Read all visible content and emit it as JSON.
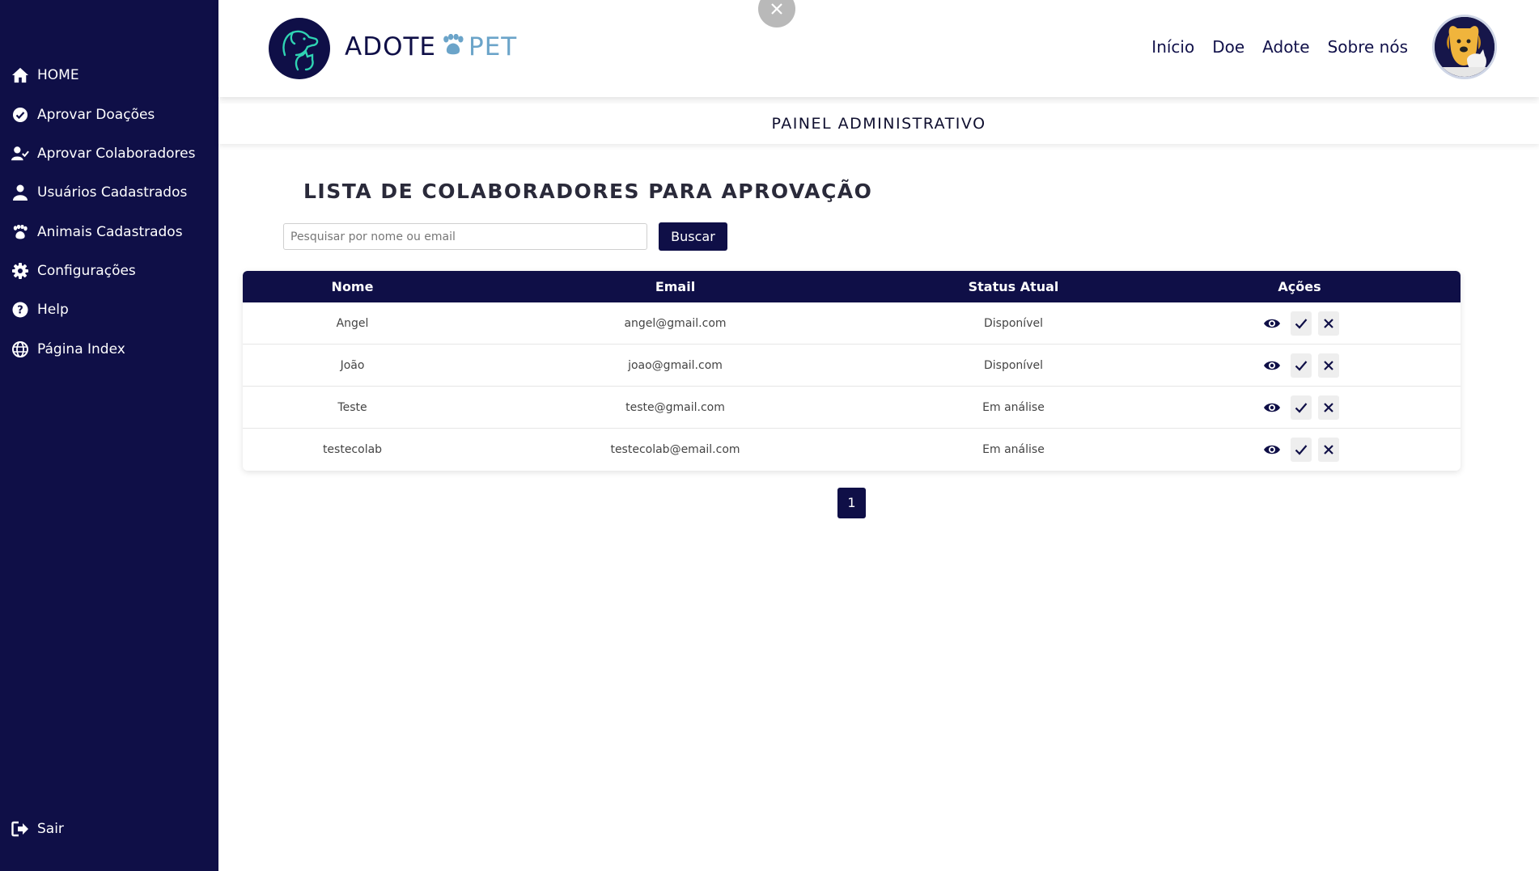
{
  "sidebar": {
    "items": [
      {
        "label": "HOME",
        "icon": "home-icon"
      },
      {
        "label": "Aprovar Doações",
        "icon": "check-circle-icon"
      },
      {
        "label": "Aprovar Colaboradores",
        "icon": "user-check-icon"
      },
      {
        "label": "Usuários Cadastrados",
        "icon": "user-icon"
      },
      {
        "label": "Animais Cadastrados",
        "icon": "paw-icon"
      },
      {
        "label": "Configurações",
        "icon": "gear-icon"
      },
      {
        "label": "Help",
        "icon": "question-circle-icon"
      },
      {
        "label": "Página Index",
        "icon": "globe-icon"
      }
    ],
    "logout_label": "Sair"
  },
  "header": {
    "brand_part1": "ADOTE",
    "brand_part2": "PET",
    "nav": [
      "Início",
      "Doe",
      "Adote",
      "Sobre nós"
    ]
  },
  "panel_title": "PAINEL ADMINISTRATIVO",
  "list_title": "LISTA DE COLABORADORES PARA APROVAÇÃO",
  "search": {
    "placeholder": "Pesquisar por nome ou email",
    "button_label": "Buscar"
  },
  "table": {
    "headers": [
      "Nome",
      "Email",
      "Status Atual",
      "Ações"
    ],
    "rows": [
      {
        "nome": "Angel",
        "email": "angel@gmail.com",
        "status": "Disponível"
      },
      {
        "nome": "João",
        "email": "joao@gmail.com",
        "status": "Disponível"
      },
      {
        "nome": "Teste",
        "email": "teste@gmail.com",
        "status": "Em análise"
      },
      {
        "nome": "testecolab",
        "email": "testecolab@email.com",
        "status": "Em análise"
      }
    ]
  },
  "pagination": {
    "current_page": "1"
  },
  "colors": {
    "primary": "#0f0f47",
    "accent": "#6ba4c9"
  }
}
